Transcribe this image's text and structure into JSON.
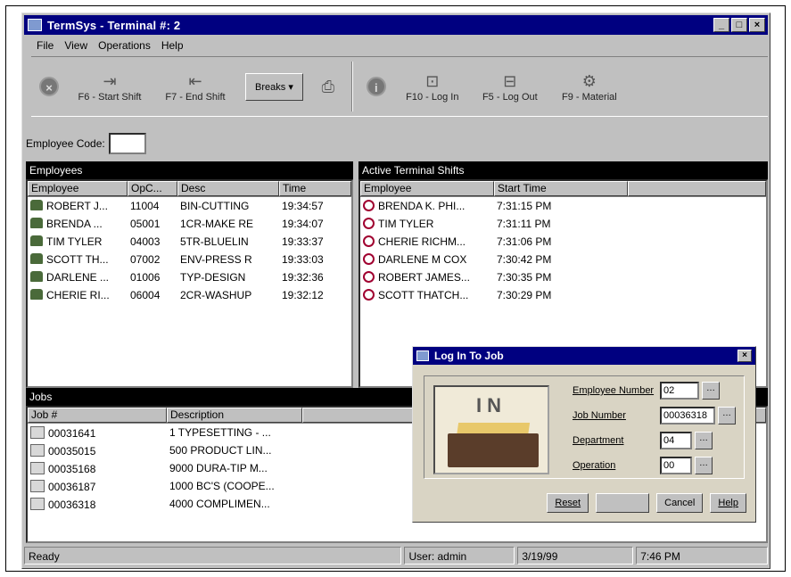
{
  "window": {
    "title": "TermSys - Terminal #: 2"
  },
  "menu": [
    "File",
    "View",
    "Operations",
    "Help"
  ],
  "toolbar": {
    "start_shift": "F6 - Start Shift",
    "end_shift": "F7 - End Shift",
    "breaks": "Breaks",
    "log_in": "F10 - Log In",
    "log_out": "F5 - Log Out",
    "material": "F9 - Material"
  },
  "employee_code": {
    "label": "Employee Code:",
    "value": ""
  },
  "employees": {
    "header": "Employees",
    "columns": [
      "Employee",
      "OpC...",
      "Desc",
      "Time"
    ],
    "rows": [
      [
        "ROBERT J...",
        "11004",
        "BIN-CUTTING",
        "19:34:57"
      ],
      [
        "BRENDA ...",
        "05001",
        "1CR-MAKE RE",
        "19:34:07"
      ],
      [
        "TIM TYLER",
        "04003",
        "5TR-BLUELIN",
        "19:33:37"
      ],
      [
        "SCOTT TH...",
        "07002",
        "ENV-PRESS R",
        "19:33:03"
      ],
      [
        "DARLENE ...",
        "01006",
        "TYP-DESIGN",
        "19:32:36"
      ],
      [
        "CHERIE RI...",
        "06004",
        "2CR-WASHUP",
        "19:32:12"
      ]
    ]
  },
  "shifts": {
    "header": "Active Terminal Shifts",
    "columns": [
      "Employee",
      "Start Time"
    ],
    "rows": [
      [
        "BRENDA K. PHI...",
        "7:31:15 PM"
      ],
      [
        "TIM TYLER",
        "7:31:11 PM"
      ],
      [
        "CHERIE RICHM...",
        "7:31:06 PM"
      ],
      [
        "DARLENE M COX",
        "7:30:42 PM"
      ],
      [
        "ROBERT JAMES...",
        "7:30:35 PM"
      ],
      [
        "SCOTT THATCH...",
        "7:30:29 PM"
      ]
    ]
  },
  "jobs": {
    "header": "Jobs",
    "columns": [
      "Job #",
      "Description"
    ],
    "rows": [
      [
        "00031641",
        "1 TYPESETTING - ..."
      ],
      [
        "00035015",
        "500 PRODUCT LIN..."
      ],
      [
        "00035168",
        "9000 DURA-TIP M..."
      ],
      [
        "00036187",
        "1000 BC'S (COOPE..."
      ],
      [
        "00036318",
        "4000 COMPLIMEN..."
      ]
    ]
  },
  "status": {
    "ready": "Ready",
    "user": "User: admin",
    "date": "3/19/99",
    "time": "7:46 PM"
  },
  "dialog": {
    "title": "Log In To Job",
    "image_text": "IN",
    "fields": [
      {
        "label": "Employee Number",
        "value": "02"
      },
      {
        "label": "Job Number",
        "value": "00036318"
      },
      {
        "label": "Department",
        "value": "04"
      },
      {
        "label": "Operation",
        "value": "00"
      }
    ],
    "buttons": {
      "reset": "Reset",
      "ok": "",
      "cancel": "Cancel",
      "help": "Help"
    }
  },
  "icons": {
    "employee_row": "employee-icon",
    "shift_row": "clock-icon",
    "job_row": "job-icon"
  }
}
